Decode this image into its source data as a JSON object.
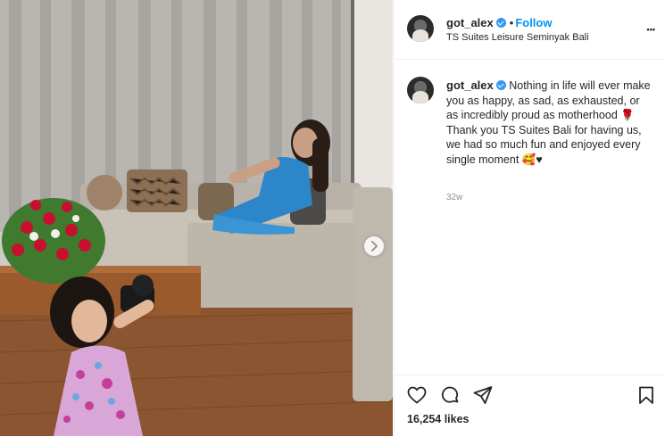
{
  "post": {
    "username": "got_alex",
    "follow_label": "Follow",
    "dot": "•",
    "location": "TS Suites Leisure Seminyak Bali",
    "more_label": "•••",
    "caption_text": "Nothing in life will ever make you as happy, as sad, as exhausted, or as incredibly proud as motherhood 🌹 Thank you TS Suites Bali for having us, we had so much fun and enjoyed every single moment 🥰♥",
    "time_ago": "32w",
    "likes": "16,254 likes"
  },
  "icons": {
    "verified": "verified-badge-icon",
    "like": "heart-icon",
    "comment": "comment-icon",
    "share": "paper-plane-icon",
    "save": "bookmark-icon",
    "next": "chevron-right-icon"
  },
  "colors": {
    "follow": "#0095f6",
    "verified": "#3897f0",
    "muted": "#8e8e8e"
  }
}
